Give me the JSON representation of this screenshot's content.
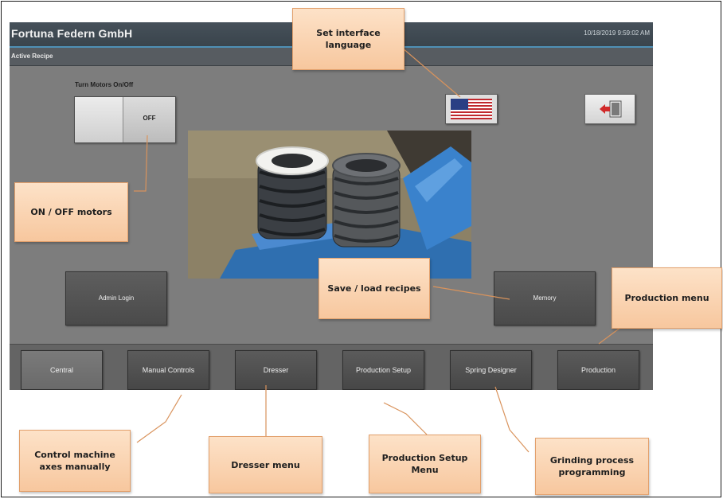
{
  "app": {
    "title": "Fortuna Federn GmbH",
    "datetime": "10/18/2019 9:59:02 AM",
    "active_view": "Active Recipe"
  },
  "motors": {
    "label": "Turn Motors On/Off",
    "state_text": "OFF",
    "is_on": false
  },
  "buttons": {
    "language_icon": "us-flag-icon",
    "exit_icon": "exit-door-icon",
    "admin_login": "Admin Login",
    "memory": "Memory"
  },
  "nav": {
    "items": [
      {
        "label": "Central",
        "active": true
      },
      {
        "label": "Manual Controls",
        "active": false
      },
      {
        "label": "Dresser",
        "active": false
      },
      {
        "label": "Production Setup",
        "active": false
      },
      {
        "label": "Spring Designer",
        "active": false
      },
      {
        "label": "Production",
        "active": false
      }
    ]
  },
  "callouts": {
    "language": "Set interface language",
    "motors": "ON / OFF motors",
    "recipes": "Save / load recipes",
    "production": "Production menu",
    "manual": "Control machine axes manually",
    "dresser": "Dresser menu",
    "setup": "Production Setup Menu",
    "designer": "Grinding process programming"
  },
  "colors": {
    "callout_fill": "#f9d2ae",
    "callout_border": "#e2a06c",
    "title_bar": "#3f4a52",
    "accent_line": "#4f8fb5",
    "panel_gray": "#7d7d7d",
    "button_dark": "#505050"
  }
}
